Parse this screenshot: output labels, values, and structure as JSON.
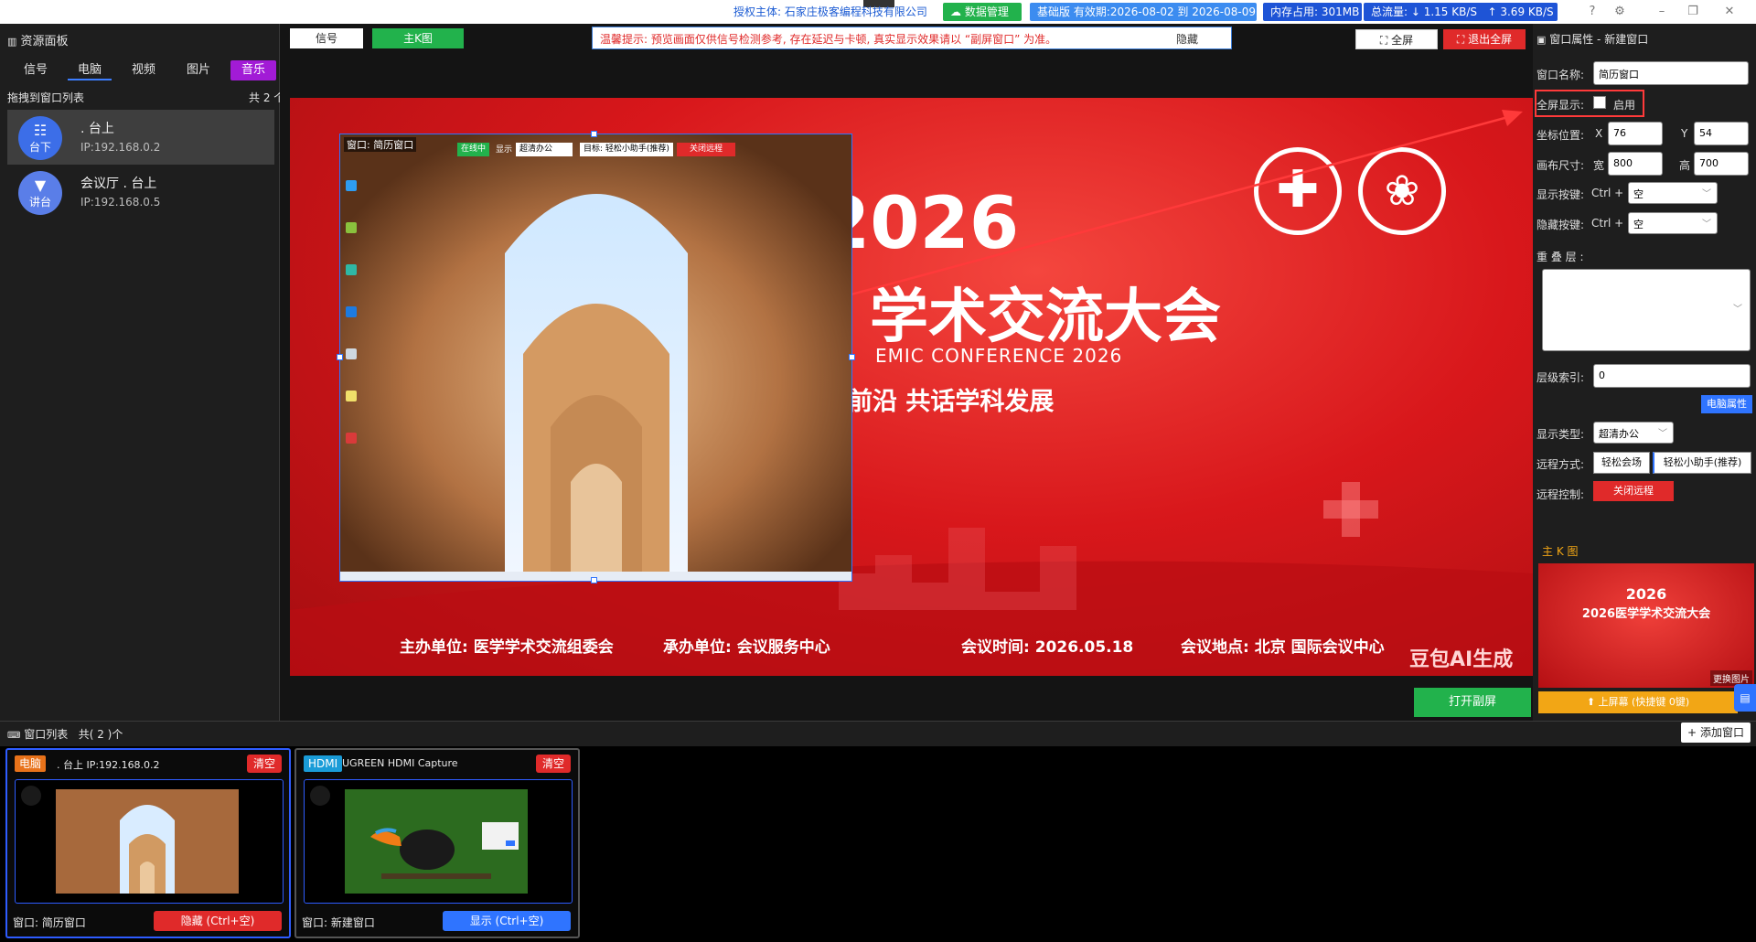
{
  "topbar": {
    "licensee": "授权主体: 石家庄极客编程科技有限公司",
    "data_mgmt": "数据管理",
    "edition": "基础版 有效期:2026-08-02 到 2026-08-09",
    "memory": "内存占用: 301MB",
    "net_down": "总流量: ↓ 1.15 KB/S",
    "net_up": "↑ 3.69 KB/S"
  },
  "left_panel": {
    "title": "资源面板",
    "tabs": [
      "信号",
      "电脑",
      "视频",
      "图片",
      "音乐"
    ],
    "drag_hint": "拖拽到窗口列表",
    "count": "共 2 个",
    "devices": [
      {
        "icon_label": "台下",
        "name": ". 台上",
        "ip": "IP:192.168.0.2"
      },
      {
        "icon_label": "讲台",
        "name": "会议厅 . 台上",
        "ip": "IP:192.168.0.5"
      }
    ]
  },
  "preview_controls": {
    "tab_signal": "信号",
    "tab_main": "主K图",
    "notice": "温馨提示: 预览画面仅供信号检测参考, 存在延迟与卡顿, 真实显示效果请以 “副屏窗口” 为准。",
    "hide": "隐藏",
    "fullscreen": "全屏",
    "exit_fullscreen": "退出全屏",
    "open_secondary": "打开副屏"
  },
  "slide": {
    "year": "2026",
    "title": "学术交流大会",
    "subtitle_en": "EMIC CONFERENCE 2026",
    "slogan": "前沿  共话学科发展",
    "footer_host": "主办单位: 医学学术交流组委会",
    "footer_org": "承办单位: 会议服务中心",
    "footer_time": "会议时间: 2026.05.18",
    "footer_place": "会议地点: 北京 国际会议中心",
    "watermark": "豆包AI生成"
  },
  "embedded_window": {
    "title": "窗口: 简历窗口",
    "status": "在线中",
    "display_label": "显示",
    "display_value": "超清办公",
    "target": "目标: 轻松小助手(推荐)",
    "close_remote": "关闭远程"
  },
  "right_panel": {
    "title": "窗口属性 - 新建窗口",
    "name_label": "窗口名称:",
    "name_value": "简历窗口",
    "fullscreen_label": "全屏显示:",
    "fullscreen_enable": "启用",
    "pos_label": "坐标位置:",
    "x_label": "X",
    "x_value": "76",
    "y_label": "Y",
    "y_value": "54",
    "size_label": "画布尺寸:",
    "w_label": "宽",
    "w_value": "800",
    "h_label": "高",
    "h_value": "700",
    "show_key_label": "显示按键:",
    "hide_key_label": "隐藏按键:",
    "ctrl": "Ctrl +",
    "key_value": "空",
    "overlay_label": "重 叠 层 :",
    "layer_label": "层级索引:",
    "layer_value": "0",
    "pc_attr": "电脑属性",
    "display_type_label": "显示类型:",
    "display_type_value": "超清办公",
    "remote_mode_label": "远程方式:",
    "remote_opt1": "轻松会场",
    "remote_opt2": "轻松小助手(推荐)",
    "remote_ctrl_label": "远程控制:",
    "remote_close": "关闭远程",
    "mainK_title": "主 K 图",
    "thumb_year": "2026",
    "thumb_title": "2026医学学术交流大会",
    "replace_image": "更换图片",
    "upload_screen": "⬆ 上屏幕  (快捷键 0键)"
  },
  "bottom": {
    "title": "窗口列表",
    "count": "共( 2 )个",
    "add_window": "添加窗口",
    "cards": [
      {
        "tag": "电脑",
        "title": ". 台上 IP:192.168.0.2",
        "clear": "清空",
        "footer": "窗口: 简历窗口",
        "action": "隐藏 (Ctrl+空)"
      },
      {
        "tag": "HDMI",
        "title": "UGREEN HDMI Capture",
        "clear": "清空",
        "footer": "窗口: 新建窗口",
        "action": "显示 (Ctrl+空)"
      }
    ]
  },
  "colors": {
    "accent_blue": "#2f74ff",
    "danger_red": "#e02a2a",
    "green": "#22b24c",
    "music_purple": "#a21bd6",
    "gold": "#f2a615"
  }
}
